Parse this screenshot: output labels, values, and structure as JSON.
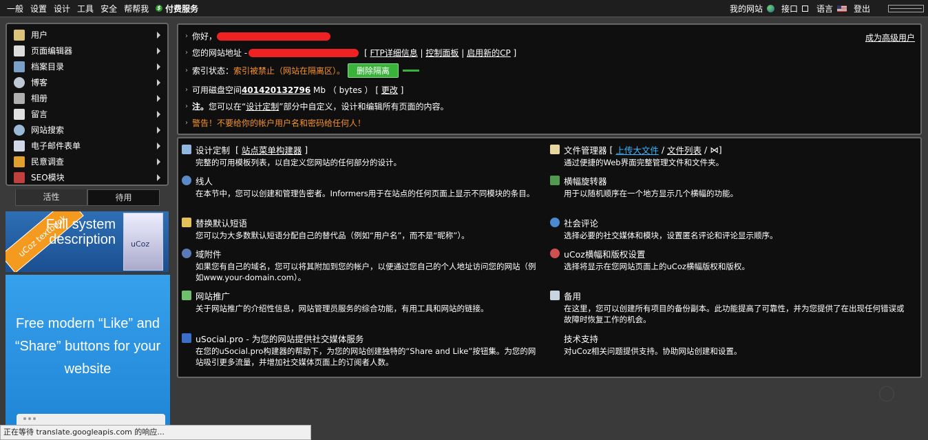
{
  "topbar": {
    "menu": [
      "一般",
      "设置",
      "设计",
      "工具",
      "安全",
      "帮帮我"
    ],
    "paid": "付费服务",
    "my_site": "我的网站",
    "interface": "接口",
    "language": "语言",
    "logout": "登出"
  },
  "sidebar": {
    "items": [
      {
        "label": "用户",
        "icon": "users-icon",
        "color": "#d9c27a"
      },
      {
        "label": "页面编辑器",
        "icon": "page-icon",
        "color": "#dcdcdc"
      },
      {
        "label": "档案目录",
        "icon": "archive-icon",
        "color": "#7aa0c8"
      },
      {
        "label": "博客",
        "icon": "blog-icon",
        "color": "#bfc9d4"
      },
      {
        "label": "相册",
        "icon": "camera-icon",
        "color": "#b0b0b0"
      },
      {
        "label": "留言",
        "icon": "guestbook-icon",
        "color": "#e0e0e0"
      },
      {
        "label": "网站搜索",
        "icon": "search-icon",
        "color": "#9ab8d8"
      },
      {
        "label": "电子邮件表单",
        "icon": "email-icon",
        "color": "#d0d8e8"
      },
      {
        "label": "民意调查",
        "icon": "poll-icon",
        "color": "#e0a030"
      },
      {
        "label": "SEO模块",
        "icon": "rocket-icon",
        "color": "#c04040"
      }
    ],
    "tabs": {
      "active": "活性",
      "inactive": "待用"
    }
  },
  "banners": {
    "ribbon": "uCoz textbook",
    "full": "Full system description",
    "book": "uCoz",
    "social": "Free modern “Like” and “Share” buttons for your website"
  },
  "info": {
    "hello": "你好，",
    "upgrade": "成为高级用户",
    "site_addr_label": "您的网站地址 -",
    "ftp": "FTP详细信息",
    "cp": "控制面板",
    "new_cp": "启用新的CP",
    "index_label": "索引状态：",
    "index_status": "索引被禁止（网站在隔离区）。",
    "remove_quarantine": "删除隔离",
    "disk_label": "可用磁盘空间",
    "disk_value": "401420132796",
    "disk_unit": "Mb （ bytes ）",
    "change": "更改",
    "note_bold": "注。",
    "note_text_a": "您可以在“",
    "note_link": "设计定制",
    "note_text_b": "”部分中自定义，设计和编辑所有页面的内容。",
    "warning": "警告！不要给你的帐户用户名和密码给任何人！"
  },
  "features": {
    "design": {
      "title": "设计定制",
      "link": "站点菜单构建器",
      "desc": "完整的可用模板列表，以自定义您网站的任何部分的设计。"
    },
    "informers": {
      "title": "线人",
      "desc": "在本节中，您可以创建和管理告密者。Informers用于在站点的任何页面上显示不同模块的条目。"
    },
    "replace": {
      "title": "替换默认短语",
      "desc": "您可以为大多数默认短语分配自己的替代品（例如“用户名”，而不是“昵称”）。"
    },
    "domain": {
      "title": "域附件",
      "desc": "如果您有自己的域名，您可以将其附加到您的帐户，以便通过您自己的个人地址访问您的网站（例如www.your-domain.com）。"
    },
    "promo": {
      "title": "网站推广",
      "desc": "关于网站推广的介绍性信息，网站管理员服务的综合功能，有用工具和网站的链接。"
    },
    "usocial": {
      "title": "uSocial.pro - 为您的网站提供社交媒体服务",
      "desc": "在您的uSocial.pro构建器的帮助下，为您的网站创建独特的“Share and Like”按钮集。为您的网站吸引更多流量，并增加社交媒体页面上的订阅者人数。"
    },
    "files": {
      "title": "文件管理器",
      "link1": "上传大文件",
      "link2": "文件列表",
      "desc": "通过便捷的Web界面完整管理文件和文件夹。"
    },
    "banners": {
      "title": "横幅旋转器",
      "desc": "用于以随机顺序在一个地方显示几个横幅的功能。"
    },
    "comments": {
      "title": "社会评论",
      "desc": "选择必要的社交媒体和模块，设置匿名评论和评论显示顺序。"
    },
    "copyright": {
      "title": "uCoz横幅和版权设置",
      "desc": "选择将显示在您网站页面上的uCoz横幅版权和版权。"
    },
    "backup": {
      "title": "备用",
      "desc": "在这里，您可以创建所有项目的备份副本。此功能提高了可靠性，并为您提供了在出现任何错误或故障时恢复工作的机会。"
    },
    "support": {
      "title": "技术支持",
      "desc": "对uCoz相关问题提供支持。协助网站创建和设置。"
    }
  },
  "statusbar": "正在等待 translate.googleapis.com 的响应..."
}
